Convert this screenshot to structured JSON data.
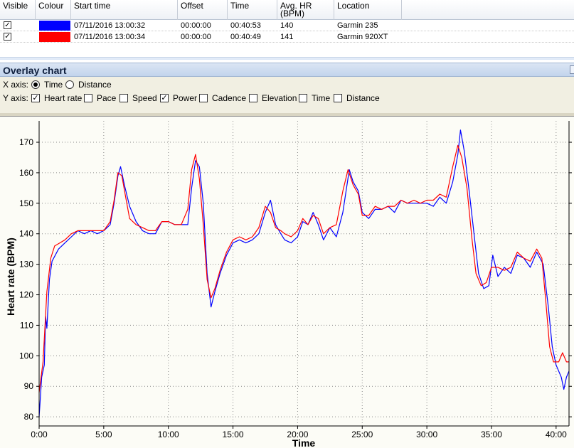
{
  "grid": {
    "columns": [
      "Visible",
      "Colour",
      "Start time",
      "Offset",
      "Time",
      "Avg. HR (BPM)",
      "Location"
    ],
    "rows": [
      {
        "visible": true,
        "colour": "#0000ff",
        "start_time": "07/11/2016 13:00:32",
        "offset": "00:00:00",
        "time": "00:40:53",
        "avg_hr": "140",
        "location": "Garmin 235"
      },
      {
        "visible": true,
        "colour": "#ff0000",
        "start_time": "07/11/2016 13:00:34",
        "offset": "00:00:00",
        "time": "00:40:49",
        "avg_hr": "141",
        "location": "Garmin 920XT"
      }
    ]
  },
  "panel": {
    "title": "Overlay chart",
    "x_axis_label": "X axis:",
    "x_options": [
      {
        "label": "Time",
        "selected": true
      },
      {
        "label": "Distance",
        "selected": false
      }
    ],
    "y_axis_label": "Y axis:",
    "y_options": [
      {
        "label": "Heart rate",
        "checked": true
      },
      {
        "label": "Pace",
        "checked": false
      },
      {
        "label": "Speed",
        "checked": false
      },
      {
        "label": "Power",
        "checked": true
      },
      {
        "label": "Cadence",
        "checked": false
      },
      {
        "label": "Elevation",
        "checked": false
      },
      {
        "label": "Time",
        "checked": false
      },
      {
        "label": "Distance",
        "checked": false
      }
    ]
  },
  "chart_data": {
    "type": "line",
    "xlabel": "Time",
    "ylabel": "Heart rate (BPM)",
    "x_unit": "minutes",
    "xlim": [
      0,
      41
    ],
    "ylim": [
      77,
      177
    ],
    "x_ticks": [
      {
        "value": 0,
        "label": "0:00"
      },
      {
        "value": 5,
        "label": "5:00"
      },
      {
        "value": 10,
        "label": "10:00"
      },
      {
        "value": 15,
        "label": "15:00"
      },
      {
        "value": 20,
        "label": "20:00"
      },
      {
        "value": 25,
        "label": "25:00"
      },
      {
        "value": 30,
        "label": "30:00"
      },
      {
        "value": 35,
        "label": "35:00"
      },
      {
        "value": 40,
        "label": "40:00"
      }
    ],
    "y_ticks": [
      80,
      90,
      100,
      110,
      120,
      130,
      140,
      150,
      160,
      170
    ],
    "grid": true,
    "series": [
      {
        "name": "Garmin 235",
        "color": "#0000ff",
        "points": [
          [
            0,
            80
          ],
          [
            0.2,
            93
          ],
          [
            0.4,
            97
          ],
          [
            0.5,
            113
          ],
          [
            0.6,
            109
          ],
          [
            0.8,
            125
          ],
          [
            1,
            131
          ],
          [
            1.5,
            135
          ],
          [
            2,
            137
          ],
          [
            2.5,
            139
          ],
          [
            3,
            141
          ],
          [
            3.5,
            140
          ],
          [
            4,
            141
          ],
          [
            4.5,
            140
          ],
          [
            5,
            141
          ],
          [
            5.5,
            143
          ],
          [
            5.8,
            150
          ],
          [
            6.1,
            159
          ],
          [
            6.3,
            162
          ],
          [
            6.6,
            156
          ],
          [
            7,
            149
          ],
          [
            7.5,
            144
          ],
          [
            8,
            141
          ],
          [
            8.5,
            140
          ],
          [
            9,
            140
          ],
          [
            9.5,
            144
          ],
          [
            10,
            144
          ],
          [
            10.5,
            143
          ],
          [
            11,
            143
          ],
          [
            11.5,
            143
          ],
          [
            11.8,
            155
          ],
          [
            12.1,
            164
          ],
          [
            12.4,
            162
          ],
          [
            12.7,
            150
          ],
          [
            13,
            127
          ],
          [
            13.3,
            116
          ],
          [
            13.6,
            121
          ],
          [
            14,
            127
          ],
          [
            14.5,
            133
          ],
          [
            15,
            137
          ],
          [
            15.5,
            138
          ],
          [
            16,
            137
          ],
          [
            16.5,
            138
          ],
          [
            17,
            140
          ],
          [
            17.5,
            147
          ],
          [
            17.9,
            151
          ],
          [
            18.3,
            143
          ],
          [
            18.7,
            140
          ],
          [
            19,
            138
          ],
          [
            19.5,
            137
          ],
          [
            20,
            139
          ],
          [
            20.4,
            144
          ],
          [
            20.8,
            143
          ],
          [
            21.2,
            147
          ],
          [
            21.6,
            143
          ],
          [
            22,
            138
          ],
          [
            22.5,
            142
          ],
          [
            23,
            139
          ],
          [
            23.5,
            147
          ],
          [
            24,
            161
          ],
          [
            24.3,
            157
          ],
          [
            24.7,
            154
          ],
          [
            25,
            147
          ],
          [
            25.5,
            145
          ],
          [
            26,
            148
          ],
          [
            26.5,
            148
          ],
          [
            27,
            149
          ],
          [
            27.5,
            147
          ],
          [
            28,
            151
          ],
          [
            28.5,
            150
          ],
          [
            29,
            150
          ],
          [
            29.5,
            150
          ],
          [
            30,
            150
          ],
          [
            30.5,
            149
          ],
          [
            31,
            152
          ],
          [
            31.5,
            150
          ],
          [
            32,
            157
          ],
          [
            32.4,
            166
          ],
          [
            32.6,
            174
          ],
          [
            32.9,
            167
          ],
          [
            33.3,
            153
          ],
          [
            33.7,
            138
          ],
          [
            34,
            127
          ],
          [
            34.4,
            122
          ],
          [
            34.8,
            123
          ],
          [
            35.1,
            133
          ],
          [
            35.5,
            126
          ],
          [
            36,
            129
          ],
          [
            36.5,
            127
          ],
          [
            37,
            133
          ],
          [
            37.5,
            132
          ],
          [
            38,
            129
          ],
          [
            38.5,
            134
          ],
          [
            39,
            130
          ],
          [
            39.4,
            116
          ],
          [
            39.7,
            103
          ],
          [
            40,
            97
          ],
          [
            40.4,
            93
          ],
          [
            40.6,
            89
          ],
          [
            40.8,
            93
          ],
          [
            41,
            95
          ]
        ]
      },
      {
        "name": "Garmin 920XT",
        "color": "#ff0000",
        "points": [
          [
            0,
            88
          ],
          [
            0.3,
            98
          ],
          [
            0.6,
            121
          ],
          [
            0.9,
            132
          ],
          [
            1.2,
            136
          ],
          [
            1.6,
            137
          ],
          [
            2,
            138
          ],
          [
            2.5,
            140
          ],
          [
            3,
            141
          ],
          [
            3.5,
            141
          ],
          [
            4,
            141
          ],
          [
            4.5,
            141
          ],
          [
            5,
            141
          ],
          [
            5.5,
            144
          ],
          [
            5.8,
            151
          ],
          [
            6.1,
            160
          ],
          [
            6.4,
            159
          ],
          [
            6.7,
            152
          ],
          [
            7,
            145
          ],
          [
            7.5,
            143
          ],
          [
            8,
            142
          ],
          [
            8.5,
            141
          ],
          [
            9,
            141
          ],
          [
            9.5,
            144
          ],
          [
            10,
            144
          ],
          [
            10.5,
            143
          ],
          [
            11,
            143
          ],
          [
            11.5,
            148
          ],
          [
            11.8,
            161
          ],
          [
            12.1,
            166
          ],
          [
            12.4,
            158
          ],
          [
            12.7,
            143
          ],
          [
            13,
            125
          ],
          [
            13.3,
            119
          ],
          [
            13.6,
            122
          ],
          [
            14,
            128
          ],
          [
            14.5,
            134
          ],
          [
            15,
            138
          ],
          [
            15.5,
            139
          ],
          [
            16,
            138
          ],
          [
            16.5,
            139
          ],
          [
            17,
            142
          ],
          [
            17.5,
            149
          ],
          [
            17.9,
            147
          ],
          [
            18.3,
            142
          ],
          [
            18.7,
            141
          ],
          [
            19,
            140
          ],
          [
            19.5,
            139
          ],
          [
            20,
            141
          ],
          [
            20.4,
            145
          ],
          [
            20.8,
            143
          ],
          [
            21.2,
            146
          ],
          [
            21.6,
            145
          ],
          [
            22,
            140
          ],
          [
            22.5,
            142
          ],
          [
            23,
            143
          ],
          [
            23.5,
            154
          ],
          [
            23.9,
            161
          ],
          [
            24.3,
            156
          ],
          [
            24.7,
            153
          ],
          [
            25,
            146
          ],
          [
            25.5,
            146
          ],
          [
            26,
            149
          ],
          [
            26.5,
            148
          ],
          [
            27,
            149
          ],
          [
            27.5,
            149
          ],
          [
            28,
            151
          ],
          [
            28.5,
            150
          ],
          [
            29,
            151
          ],
          [
            29.5,
            150
          ],
          [
            30,
            151
          ],
          [
            30.5,
            151
          ],
          [
            31,
            153
          ],
          [
            31.5,
            152
          ],
          [
            32,
            162
          ],
          [
            32.4,
            169
          ],
          [
            32.7,
            165
          ],
          [
            33.1,
            155
          ],
          [
            33.5,
            138
          ],
          [
            33.8,
            127
          ],
          [
            34.2,
            123
          ],
          [
            34.6,
            124
          ],
          [
            35,
            129
          ],
          [
            35.5,
            129
          ],
          [
            36,
            128
          ],
          [
            36.5,
            129
          ],
          [
            37,
            134
          ],
          [
            37.5,
            132
          ],
          [
            38,
            131
          ],
          [
            38.5,
            135
          ],
          [
            38.9,
            132
          ],
          [
            39.2,
            118
          ],
          [
            39.5,
            103
          ],
          [
            39.8,
            98
          ],
          [
            40.2,
            98
          ],
          [
            40.5,
            101
          ],
          [
            40.8,
            98
          ],
          [
            41,
            98
          ]
        ]
      }
    ]
  }
}
